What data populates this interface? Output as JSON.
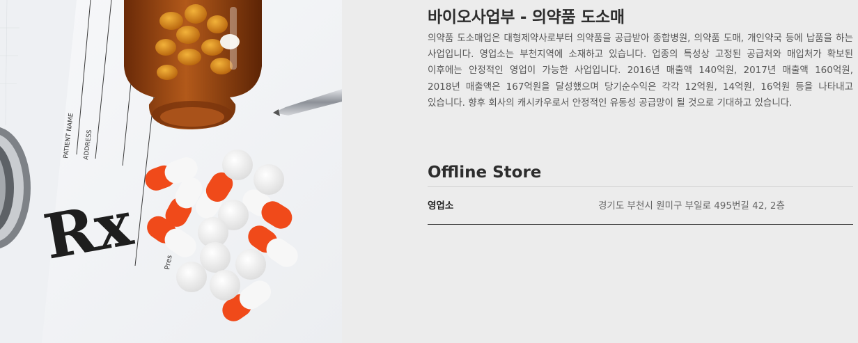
{
  "section": {
    "title": "바이오사업부 - 의약품 도소매",
    "description": "의약품 도소매업은 대형제약사로부터 의약품을 공급받아 종합병원, 의약품 도매, 개인약국 등에 납품을 하는 사업입니다. 영업소는 부천지역에 소재하고 있습니다. 업종의 특성상 고정된 공급처와 매입처가 확보된 이후에는 안정적인 영업이 가능한 사업입니다. 2016년 매출액 140억원, 2017년 매출액 160억원, 2018년 매출액은 167억원을 달성했으며 당기순수익은 각각 12억원, 14억원, 16억원 등을 나타내고 있습니다. 향후 회사의 캐시카우로서 안정적인 유동성 공급망이 될 것으로 기대하고 있습니다."
  },
  "photo": {
    "prescription_labels": [
      "PATIENT NAME",
      "ADDRESS",
      "Rx",
      "Pres"
    ]
  },
  "offline_store": {
    "heading": "Offline Store",
    "rows": [
      {
        "label": "영업소",
        "address": "경기도 부천시 원미구 부일로 495번길 42, 2층"
      }
    ]
  },
  "colors": {
    "background": "#ececec",
    "capsule_orange": "#f04a1a",
    "bottle_amber": "#8a3e0e"
  }
}
